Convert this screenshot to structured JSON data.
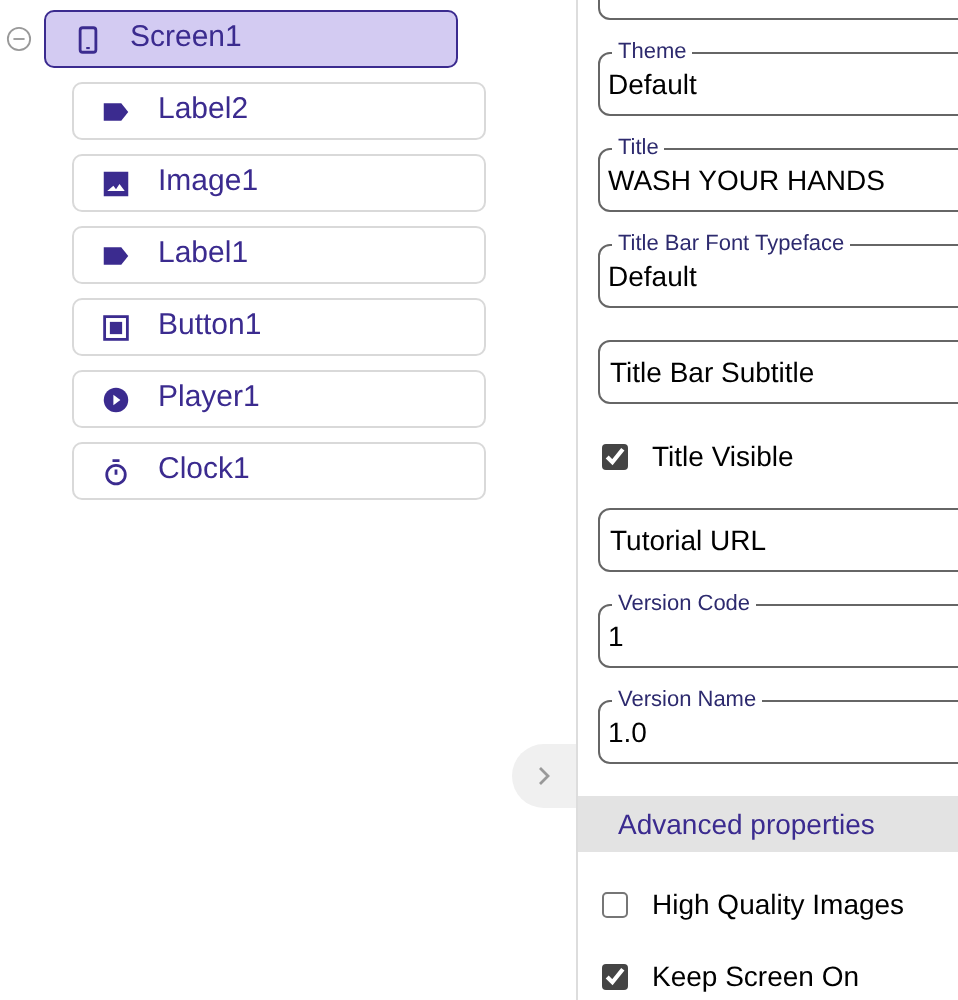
{
  "tree": {
    "root": {
      "label": "Screen1",
      "kind": "phone",
      "selected": true,
      "expanded": true,
      "children": [
        {
          "label": "Label2",
          "kind": "label",
          "selected": false
        },
        {
          "label": "Image1",
          "kind": "image",
          "selected": false
        },
        {
          "label": "Label1",
          "kind": "label",
          "selected": false
        },
        {
          "label": "Button1",
          "kind": "button",
          "selected": false
        },
        {
          "label": "Player1",
          "kind": "player",
          "selected": false
        },
        {
          "label": "Clock1",
          "kind": "clock",
          "selected": false
        }
      ]
    }
  },
  "properties": [
    {
      "kind": "field",
      "label": "Theme",
      "value": "Default"
    },
    {
      "kind": "field",
      "label": "Title",
      "value": "WASH YOUR HANDS"
    },
    {
      "kind": "field",
      "label": "Title Bar Font Typeface",
      "value": "Default"
    },
    {
      "kind": "input",
      "placeholder": "Title Bar Subtitle"
    },
    {
      "kind": "checkbox",
      "label": "Title Visible",
      "checked": true
    },
    {
      "kind": "input",
      "placeholder": "Tutorial URL"
    },
    {
      "kind": "field",
      "label": "Version Code",
      "value": "1"
    },
    {
      "kind": "field",
      "label": "Version Name",
      "value": "1.0"
    },
    {
      "kind": "section",
      "label": "Advanced properties"
    },
    {
      "kind": "checkbox",
      "label": "High Quality Images",
      "checked": false
    },
    {
      "kind": "checkbox",
      "label": "Keep Screen On",
      "checked": true
    }
  ]
}
